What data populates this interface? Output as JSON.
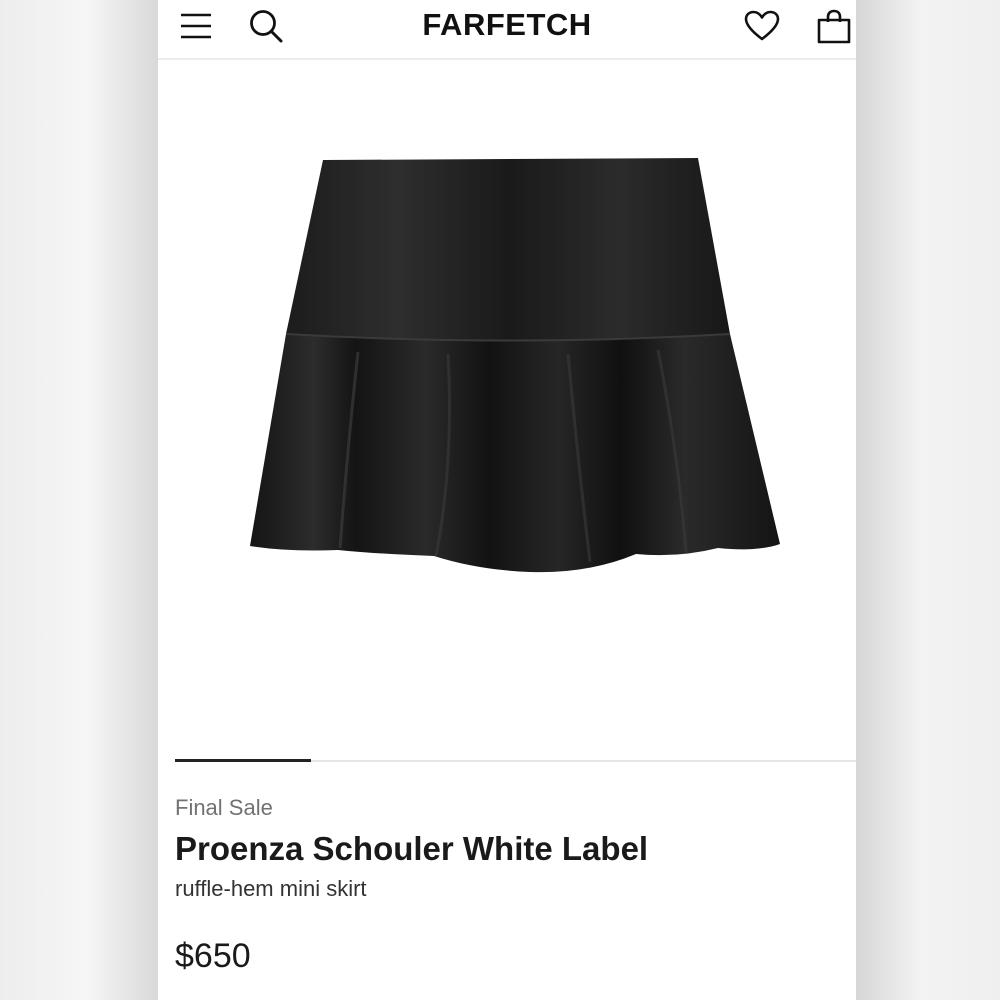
{
  "header": {
    "logo": "FARFETCH",
    "icons": [
      "menu-icon",
      "search-icon",
      "heart-icon",
      "shopping-bag-icon"
    ]
  },
  "gallery": {
    "image_alt": "Black leather ruffle-hem mini skirt",
    "progress": 0.2
  },
  "product": {
    "badge": "Final Sale",
    "brand": "Proenza Schouler White Label",
    "description": "ruffle-hem mini skirt",
    "price": "$650"
  },
  "colors": {
    "text": "#1a1a1a",
    "muted": "#727272",
    "background": "#ffffff"
  }
}
